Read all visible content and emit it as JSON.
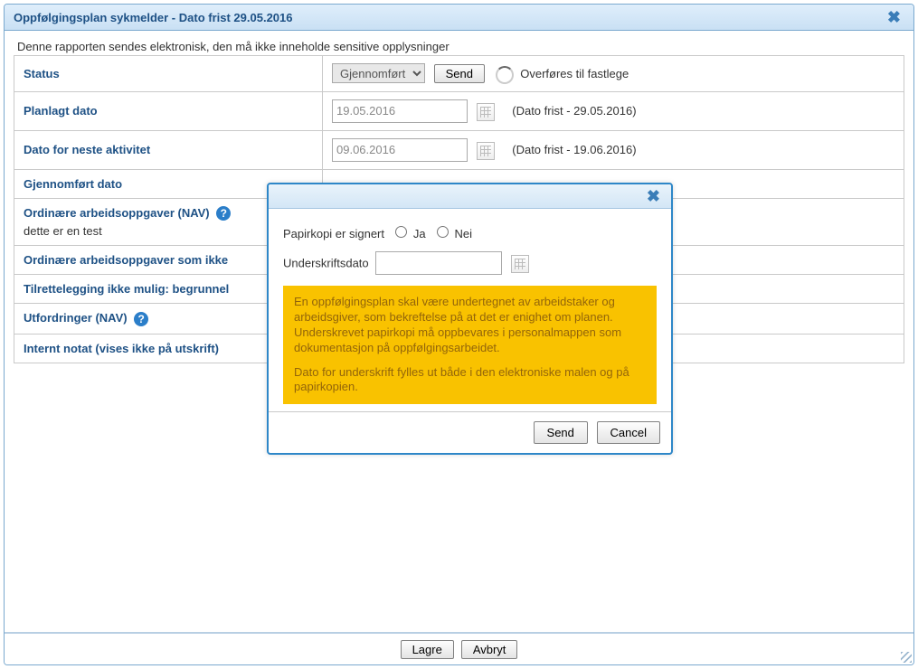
{
  "window": {
    "title": "Oppfølgingsplan sykmelder - Dato frist 29.05.2016",
    "notice": "Denne rapporten sendes elektronisk, den må ikke inneholde sensitive opplysninger"
  },
  "fields": {
    "status_label": "Status",
    "status_value": "Gjennomført",
    "send_btn": "Send",
    "transfer_text": "Overføres til fastlege",
    "planned_label": "Planlagt dato",
    "planned_value": "19.05.2016",
    "planned_hint": "(Dato frist - 29.05.2016)",
    "next_label": "Dato for neste aktivitet",
    "next_value": "09.06.2016",
    "next_hint": "(Dato frist - 19.06.2016)",
    "done_label": "Gjennomført dato",
    "ord_label": "Ordinære arbeidsoppgaver (NAV)",
    "ord_sub": "dette er en test",
    "ord_not_label": "Ordinære arbeidsoppgaver som ikke",
    "tilr_label": "Tilrettelegging ikke mulig: begrunnel",
    "utf_label": "Utfordringer (NAV)",
    "note_label": "Internt notat (vises ikke på utskrift)"
  },
  "footer": {
    "save": "Lagre",
    "cancel": "Avbryt"
  },
  "modal": {
    "paper_label": "Papirkopi er signert",
    "yes": "Ja",
    "no": "Nei",
    "sig_label": "Underskriftsdato",
    "info_p1": "En oppfølgingsplan skal være undertegnet av arbeidstaker og arbeidsgiver, som bekreftelse på at det er enighet om planen. Underskrevet papirkopi må oppbevares i personalmappen som dokumentasjon på oppfølgingsarbeidet.",
    "info_p2": "Dato for underskrift fylles ut både i den elektroniske malen og på papirkopien.",
    "send": "Send",
    "cancel": "Cancel"
  }
}
